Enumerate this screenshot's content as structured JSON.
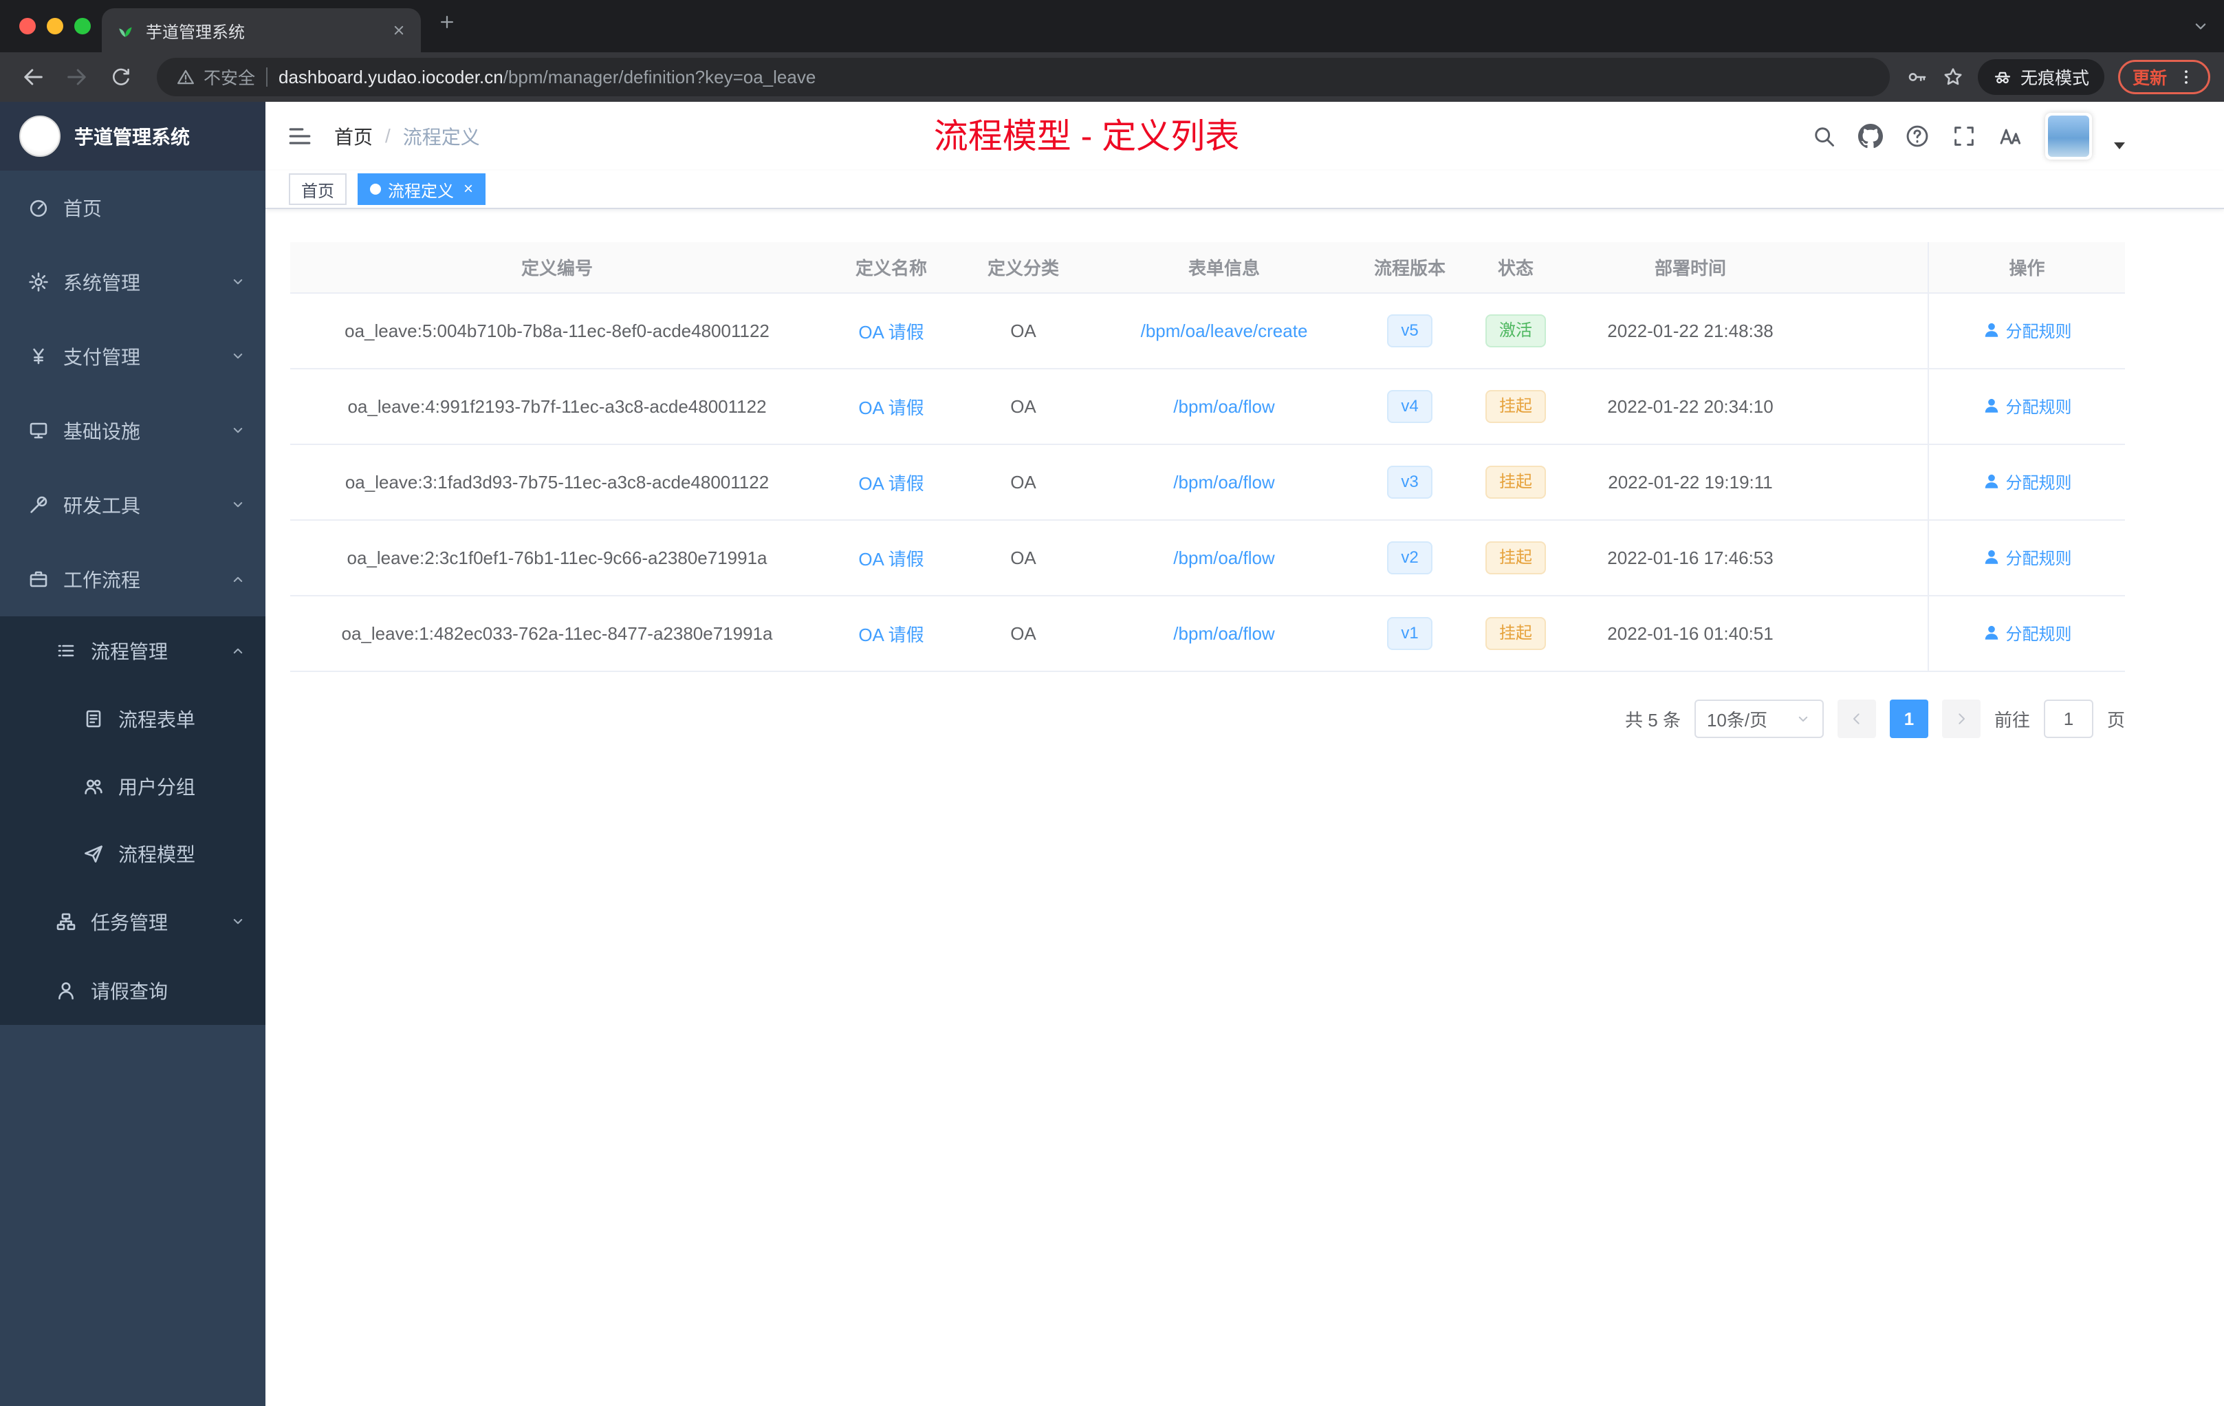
{
  "browser": {
    "tab_title": "芋道管理系统",
    "security_label": "不安全",
    "url_domain": "dashboard.yudao.iocoder.cn",
    "url_path": "/bpm/manager/definition?key=oa_leave",
    "incognito_label": "无痕模式",
    "update_label": "更新"
  },
  "sidebar": {
    "logo_title": "芋道管理系统",
    "items": [
      {
        "label": "首页"
      },
      {
        "label": "系统管理"
      },
      {
        "label": "支付管理"
      },
      {
        "label": "基础设施"
      },
      {
        "label": "研发工具"
      },
      {
        "label": "工作流程"
      },
      {
        "label": "流程管理"
      },
      {
        "label": "流程表单"
      },
      {
        "label": "用户分组"
      },
      {
        "label": "流程模型"
      },
      {
        "label": "任务管理"
      },
      {
        "label": "请假查询"
      }
    ]
  },
  "header": {
    "breadcrumb": {
      "home": "首页",
      "sep": "/",
      "current": "流程定义"
    },
    "annotation": "流程模型 - 定义列表"
  },
  "tags": {
    "first": "首页",
    "active": "流程定义",
    "close": "×"
  },
  "table": {
    "columns": [
      "定义编号",
      "定义名称",
      "定义分类",
      "表单信息",
      "流程版本",
      "状态",
      "部署时间",
      "操作"
    ],
    "action_label": "分配规则",
    "rows": [
      {
        "id": "oa_leave:5:004b710b-7b8a-11ec-8ef0-acde48001122",
        "name": "OA 请假",
        "category": "OA",
        "form": "/bpm/oa/leave/create",
        "version": "v5",
        "status": "激活",
        "status_type": "success",
        "deploy_time": "2022-01-22 21:48:38"
      },
      {
        "id": "oa_leave:4:991f2193-7b7f-11ec-a3c8-acde48001122",
        "name": "OA 请假",
        "category": "OA",
        "form": "/bpm/oa/flow",
        "version": "v4",
        "status": "挂起",
        "status_type": "warning",
        "deploy_time": "2022-01-22 20:34:10"
      },
      {
        "id": "oa_leave:3:1fad3d93-7b75-11ec-a3c8-acde48001122",
        "name": "OA 请假",
        "category": "OA",
        "form": "/bpm/oa/flow",
        "version": "v3",
        "status": "挂起",
        "status_type": "warning",
        "deploy_time": "2022-01-22 19:19:11"
      },
      {
        "id": "oa_leave:2:3c1f0ef1-76b1-11ec-9c66-a2380e71991a",
        "name": "OA 请假",
        "category": "OA",
        "form": "/bpm/oa/flow",
        "version": "v2",
        "status": "挂起",
        "status_type": "warning",
        "deploy_time": "2022-01-16 17:46:53"
      },
      {
        "id": "oa_leave:1:482ec033-762a-11ec-8477-a2380e71991a",
        "name": "OA 请假",
        "category": "OA",
        "form": "/bpm/oa/flow",
        "version": "v1",
        "status": "挂起",
        "status_type": "warning",
        "deploy_time": "2022-01-16 01:40:51"
      }
    ]
  },
  "pagination": {
    "total": "共 5 条",
    "page_size": "10条/页",
    "current": "1",
    "goto": "前往",
    "jump": "1",
    "page_unit": "页"
  },
  "colors": {
    "accent": "#409eff",
    "success": "#4db75f",
    "warning": "#e6a23c",
    "annotation_red": "#ee0a24",
    "sidebar_bg": "#304156",
    "submenu_bg": "#1f2d3d"
  }
}
